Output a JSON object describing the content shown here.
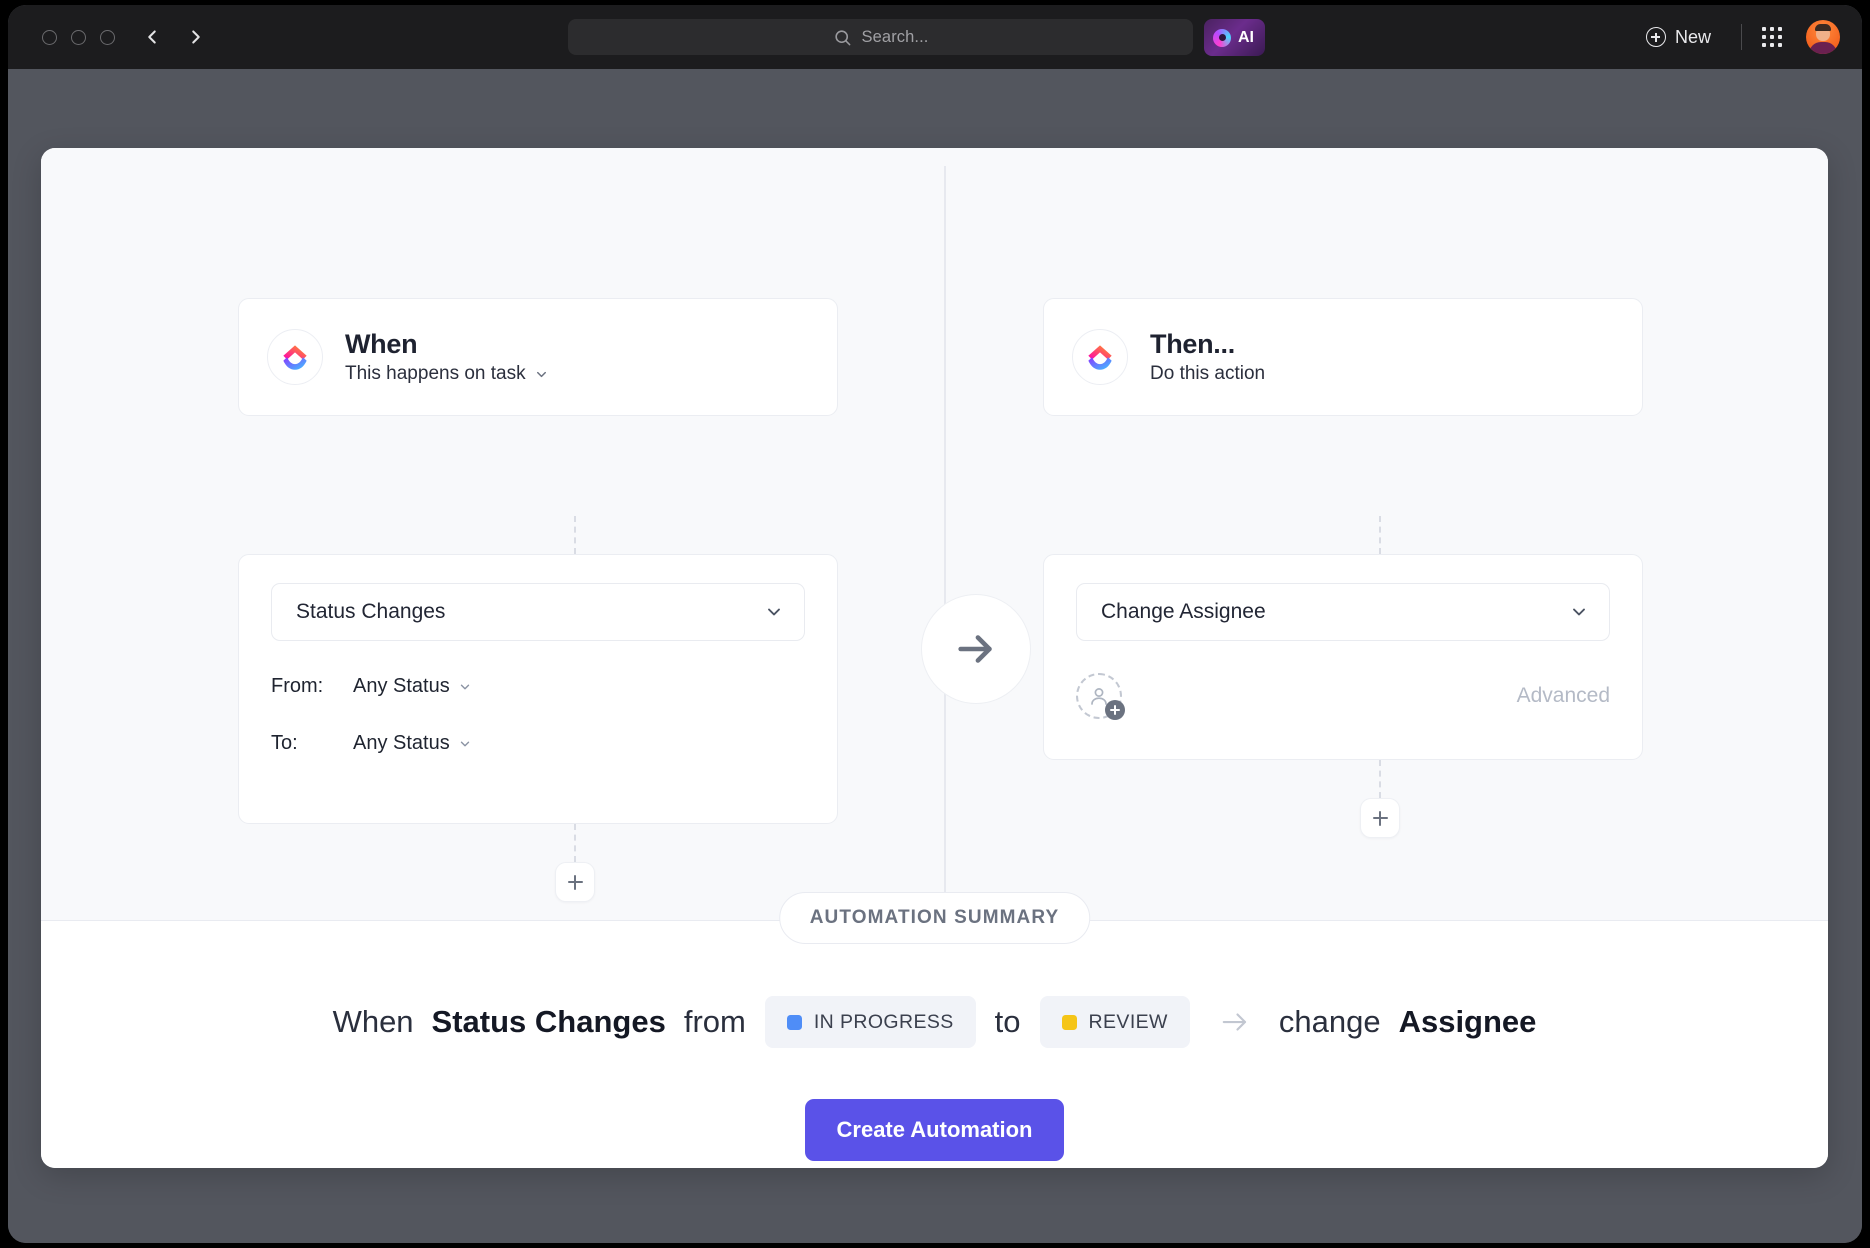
{
  "topbar": {
    "window_controls": [
      "close",
      "minimize",
      "maximize"
    ],
    "back_label": "Back",
    "forward_label": "Forward",
    "search": {
      "placeholder": "Search...",
      "value": ""
    },
    "ai_label": "AI",
    "new_label": "New",
    "apps_label": "Apps",
    "avatar_label": "Account"
  },
  "automation": {
    "when": {
      "title": "When",
      "subtitle": "This happens on task",
      "trigger": "Status Changes",
      "from_label": "From:",
      "from_value": "Any Status",
      "to_label": "To:",
      "to_value": "Any Status",
      "add_label": "+"
    },
    "then": {
      "title": "Then...",
      "subtitle": "Do this action",
      "action": "Change Assignee",
      "advanced_label": "Advanced",
      "add_label": "+"
    },
    "flow_arrow": "→"
  },
  "summary": {
    "pill_label": "AUTOMATION SUMMARY",
    "prefix": "When",
    "trigger": "Status Changes",
    "from_word": "from",
    "from_status": {
      "label": "IN PROGRESS",
      "color": "#4f8df7"
    },
    "to_word": "to",
    "to_status": {
      "label": "REVIEW",
      "color": "#f5c518"
    },
    "arrow": "→",
    "action_word": "change",
    "action_target": "Assignee",
    "create_button": "Create Automation"
  },
  "colors": {
    "accent": "#5a52e8",
    "page_bg": "#53565e",
    "panel_bg": "#f8f9fb",
    "card_bg": "#ffffff"
  }
}
